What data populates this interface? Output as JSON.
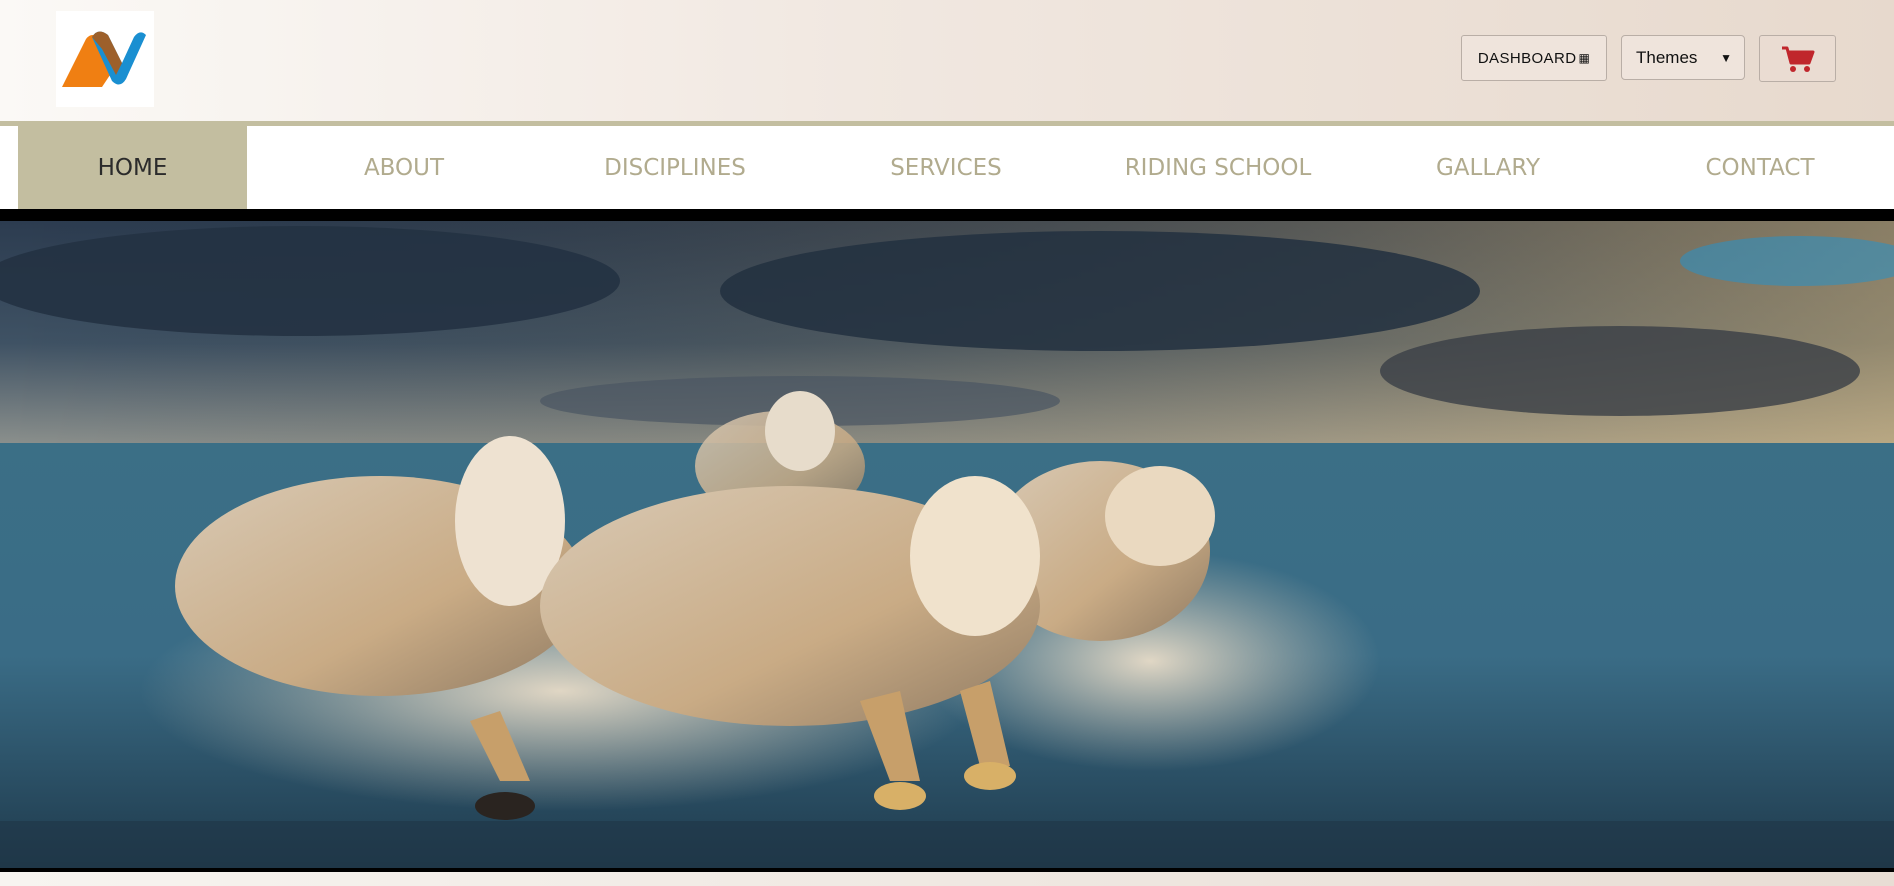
{
  "header": {
    "logo_icon": "brand-logo-icon",
    "dashboard_label": "DASHBOARD",
    "dashboard_icon": "qr-code-icon",
    "themes_select": {
      "selected": "Themes",
      "options": [
        "Themes"
      ]
    },
    "cart_icon": "shopping-cart-icon",
    "colors": {
      "brand_olive": "#c3bea0",
      "cart_red": "#c0262c",
      "logo_orange": "#f07f12",
      "logo_blue": "#1a8fd1"
    }
  },
  "nav": {
    "items": [
      {
        "label": "HOME",
        "active": true
      },
      {
        "label": "ABOUT",
        "active": false
      },
      {
        "label": "DISCIPLINES",
        "active": false
      },
      {
        "label": "SERVICES",
        "active": false
      },
      {
        "label": "RIDING SCHOOL",
        "active": false
      },
      {
        "label": "GALLARY",
        "active": false
      },
      {
        "label": "CONTACT",
        "active": false
      }
    ]
  },
  "hero": {
    "subject": "hero-image-white-horses-running-in-sea"
  }
}
